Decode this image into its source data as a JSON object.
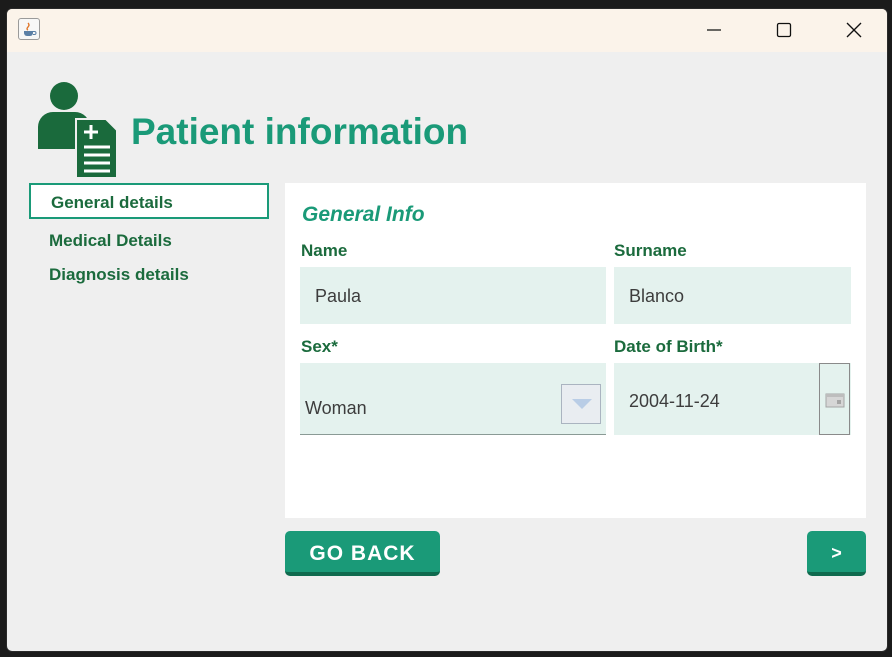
{
  "window": {
    "controls": {
      "minimize": "minimize-icon",
      "maximize": "maximize-icon",
      "close": "close-icon"
    }
  },
  "header": {
    "title": "Patient information",
    "icon": "patient-document-icon"
  },
  "sidebar": {
    "items": [
      {
        "label": "General details",
        "active": true
      },
      {
        "label": "Medical Details",
        "active": false
      },
      {
        "label": "Diagnosis details",
        "active": false
      }
    ]
  },
  "form": {
    "section_title": "General Info",
    "name": {
      "label": "Name",
      "value": "Paula"
    },
    "surname": {
      "label": "Surname",
      "value": "Blanco"
    },
    "sex": {
      "label": "Sex*",
      "value": "Woman"
    },
    "dob": {
      "label": "Date of Birth*",
      "value": "2004-11-24"
    }
  },
  "actions": {
    "back_label": "GO BACK",
    "next_label": ">"
  },
  "colors": {
    "accent": "#1a9a78",
    "dark_green": "#1b6b3d",
    "field_bg": "#e4f2ee"
  }
}
